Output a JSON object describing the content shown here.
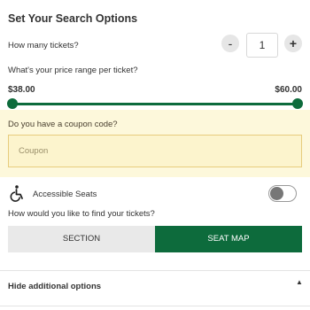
{
  "header": {
    "title": "Set Your Search Options"
  },
  "tickets": {
    "label": "How many tickets?",
    "minus": "-",
    "plus": "+",
    "value": "1"
  },
  "price": {
    "label": "What's your price range per ticket?",
    "min": "$38.00",
    "max": "$60.00"
  },
  "coupon": {
    "label": "Do you have a coupon code?",
    "placeholder": "Coupon",
    "value": ""
  },
  "accessibility": {
    "label": "Accessible Seats",
    "icon": "wheelchair-icon",
    "enabled": false
  },
  "find": {
    "label": "How would you like to find your tickets?",
    "options": [
      {
        "label": "SECTION",
        "selected": false
      },
      {
        "label": "SEAT MAP",
        "selected": true
      }
    ]
  },
  "additional": {
    "label": "Hide additional options",
    "icon": "chevron-up-icon"
  },
  "colors": {
    "accent": "#0d6b3c",
    "coupon_bg": "#fdf8db",
    "coupon_border": "#e7cc7d"
  }
}
